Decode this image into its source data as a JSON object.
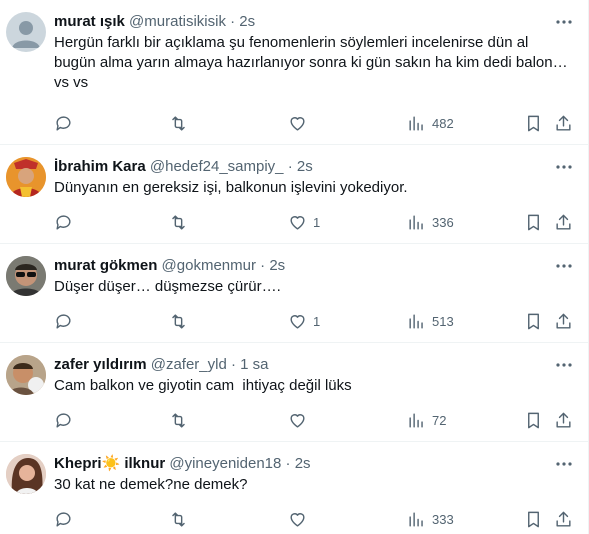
{
  "tweets": [
    {
      "name": "murat ışık",
      "handle": "@muratisikisik",
      "dot": "·",
      "time": "2s",
      "text_lines": [
        "Hergün farklı bir açıklama şu fenomenlerin söylemleri incelenirse dün al",
        "bugün alma yarın almaya hazırlanıyor sonra ki gün sakın ha kim dedi balon…",
        "vs vs"
      ],
      "likes": "",
      "views": "482",
      "avatar": {
        "kind": "default",
        "bg": "#ccd6dd",
        "fg": "#8899a6"
      }
    },
    {
      "name": "İbrahim Kara",
      "handle": "@hedef24_sampiy_",
      "dot": "·",
      "time": "2s",
      "text_lines": [
        "Dünyanın en gereksiz işi, balkonun işlevini yokediyor."
      ],
      "likes": "1",
      "views": "336",
      "avatar": {
        "kind": "photo",
        "bg": "#f0a040",
        "fg": "#3b2a1a"
      }
    },
    {
      "name": "murat gökmen",
      "handle": "@gokmenmur",
      "dot": "·",
      "time": "2s",
      "text_lines": [
        "Düşer düşer… düşmezse çürür…."
      ],
      "likes": "1",
      "views": "513",
      "avatar": {
        "kind": "photo",
        "bg": "#6b6b6b",
        "fg": "#1a1a1a"
      }
    },
    {
      "name": "zafer yıldırım",
      "handle": "@zafer_yld",
      "dot": "·",
      "time": "1 sa",
      "text_lines": [
        "Cam balkon ve giyotin cam  ihtiyaç değil lüks"
      ],
      "likes": "",
      "views": "72",
      "avatar": {
        "kind": "photo",
        "bg": "#c9a27e",
        "fg": "#5a3d2a"
      }
    },
    {
      "name": "Khepri☀️ ilknur",
      "handle": "@yineyeniden18",
      "dot": "·",
      "time": "2s",
      "text_lines": [
        "30 kat ne demek?ne demek?"
      ],
      "likes": "",
      "views": "333",
      "avatar": {
        "kind": "photo",
        "bg": "#d9b8a8",
        "fg": "#4a2c22"
      }
    }
  ],
  "icons": [
    "reply-icon",
    "retweet-icon",
    "like-icon",
    "views-icon",
    "bookmark-icon",
    "share-icon",
    "more-icon"
  ],
  "colors": {
    "text": "#0f1419",
    "secondary": "#536471",
    "divider": "#eff3f4"
  }
}
